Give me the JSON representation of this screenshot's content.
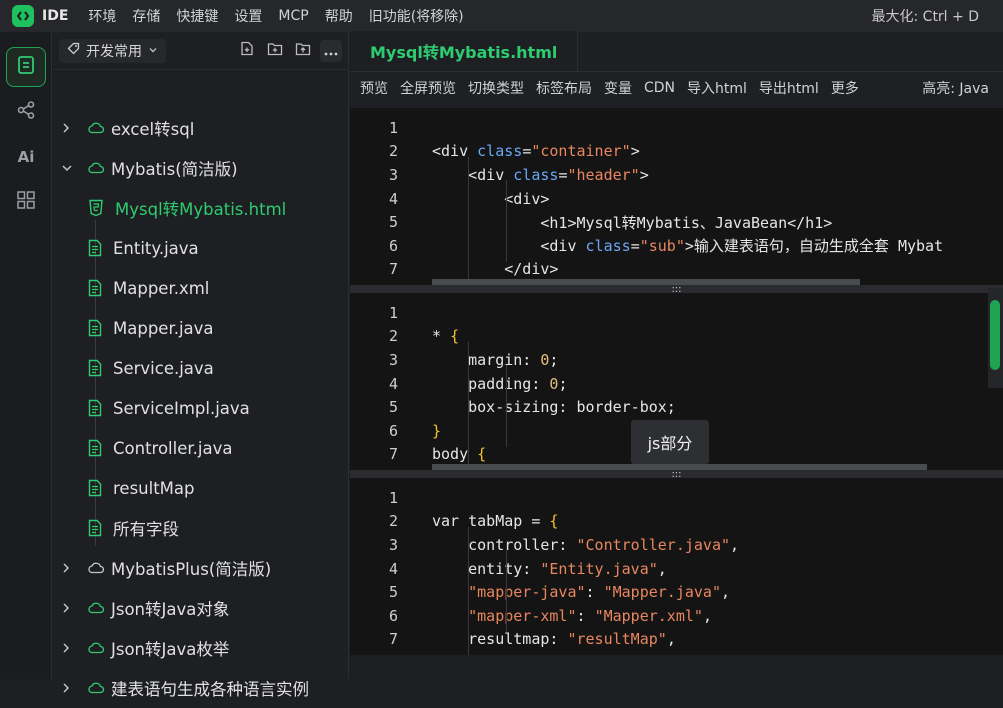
{
  "menubar": {
    "app_name": "IDE",
    "items": [
      "环境",
      "存储",
      "快捷键",
      "设置",
      "MCP",
      "帮助",
      "旧功能(将移除)"
    ],
    "maximize_hint": "最大化: Ctrl + D"
  },
  "activity": {
    "ai_label": "Ai"
  },
  "sidebar": {
    "workspace": "开发常用",
    "tree": [
      {
        "type": "folder",
        "label": "excel转sql",
        "expanded": false
      },
      {
        "type": "folder",
        "label": "Mybatis(简洁版)",
        "expanded": true
      },
      {
        "type": "file",
        "label": "Mysql转Mybatis.html",
        "icon": "html-file-icon",
        "active": true
      },
      {
        "type": "file",
        "label": "Entity.java",
        "icon": "file-icon"
      },
      {
        "type": "file",
        "label": "Mapper.xml",
        "icon": "file-icon"
      },
      {
        "type": "file",
        "label": "Mapper.java",
        "icon": "file-icon"
      },
      {
        "type": "file",
        "label": "Service.java",
        "icon": "file-icon"
      },
      {
        "type": "file",
        "label": "ServiceImpl.java",
        "icon": "file-icon"
      },
      {
        "type": "file",
        "label": "Controller.java",
        "icon": "file-icon"
      },
      {
        "type": "file",
        "label": "resultMap",
        "icon": "file-icon"
      },
      {
        "type": "file",
        "label": "所有字段",
        "icon": "file-icon"
      },
      {
        "type": "folder",
        "label": "MybatisPlus(简洁版)",
        "expanded": false
      },
      {
        "type": "folder",
        "label": "Json转Java对象",
        "expanded": false
      },
      {
        "type": "folder",
        "label": "Json转Java枚举",
        "expanded": false
      },
      {
        "type": "folder",
        "label": "建表语句生成各种语言实例",
        "expanded": false
      }
    ]
  },
  "editor": {
    "tab": "Mysql转Mybatis.html",
    "actions": [
      "预览",
      "全屏预览",
      "切换类型",
      "标签布局",
      "变量",
      "CDN",
      "导入html",
      "导出html",
      "更多"
    ],
    "highlight": "高亮: Java",
    "tooltip": "js部分",
    "html_pane": [
      {
        "n": "1",
        "tokens": []
      },
      {
        "n": "2",
        "tokens": [
          [
            "tag",
            "<div "
          ],
          [
            "attr",
            "class"
          ],
          [
            "tag",
            "="
          ],
          [
            "str",
            "\"container\""
          ],
          [
            "tag",
            ">"
          ]
        ]
      },
      {
        "n": "3",
        "tokens": [
          [
            "tag",
            "    <div "
          ],
          [
            "attr",
            "class"
          ],
          [
            "tag",
            "="
          ],
          [
            "str",
            "\"header\""
          ],
          [
            "tag",
            ">"
          ]
        ]
      },
      {
        "n": "4",
        "tokens": [
          [
            "tag",
            "        <div>"
          ]
        ]
      },
      {
        "n": "5",
        "tokens": [
          [
            "tag",
            "            <h1>Mysql转Mybatis、JavaBean</h1>"
          ]
        ]
      },
      {
        "n": "6",
        "tokens": [
          [
            "tag",
            "            <div "
          ],
          [
            "attr",
            "class"
          ],
          [
            "tag",
            "="
          ],
          [
            "str",
            "\"sub\""
          ],
          [
            "tag",
            ">输入建表语句，自动生成全套 Mybat"
          ]
        ]
      },
      {
        "n": "7",
        "tokens": [
          [
            "tag",
            "        </div>"
          ]
        ]
      }
    ],
    "css_pane": [
      {
        "n": "1",
        "tokens": []
      },
      {
        "n": "2",
        "tokens": [
          [
            "tag",
            "* "
          ],
          [
            "brace",
            "{"
          ]
        ]
      },
      {
        "n": "3",
        "tokens": [
          [
            "tag",
            "    margin: "
          ],
          [
            "num",
            "0"
          ],
          [
            "tag",
            ";"
          ]
        ]
      },
      {
        "n": "4",
        "tokens": [
          [
            "tag",
            "    padding: "
          ],
          [
            "num",
            "0"
          ],
          [
            "tag",
            ";"
          ]
        ]
      },
      {
        "n": "5",
        "tokens": [
          [
            "tag",
            "    box-sizing: border-box;"
          ]
        ]
      },
      {
        "n": "6",
        "tokens": [
          [
            "brace",
            "}"
          ]
        ]
      },
      {
        "n": "7",
        "tokens": [
          [
            "tag",
            "body "
          ],
          [
            "brace",
            "{"
          ]
        ]
      }
    ],
    "js_pane": [
      {
        "n": "1",
        "tokens": []
      },
      {
        "n": "2",
        "tokens": [
          [
            "tag",
            "var tabMap = "
          ],
          [
            "brace",
            "{"
          ]
        ]
      },
      {
        "n": "3",
        "tokens": [
          [
            "tag",
            "    controller: "
          ],
          [
            "str",
            "\"Controller.java\""
          ],
          [
            "tag",
            ","
          ]
        ]
      },
      {
        "n": "4",
        "tokens": [
          [
            "tag",
            "    entity: "
          ],
          [
            "str",
            "\"Entity.java\""
          ],
          [
            "tag",
            ","
          ]
        ]
      },
      {
        "n": "5",
        "tokens": [
          [
            "str",
            "    \"mapper-java\""
          ],
          [
            "tag",
            ": "
          ],
          [
            "str",
            "\"Mapper.java\""
          ],
          [
            "tag",
            ","
          ]
        ]
      },
      {
        "n": "6",
        "tokens": [
          [
            "str",
            "    \"mapper-xml\""
          ],
          [
            "tag",
            ": "
          ],
          [
            "str",
            "\"Mapper.xml\""
          ],
          [
            "tag",
            ","
          ]
        ]
      },
      {
        "n": "7",
        "tokens": [
          [
            "tag",
            "    resultmap: "
          ],
          [
            "str",
            "\"resultMap\""
          ],
          [
            "tag",
            ","
          ]
        ]
      }
    ]
  },
  "colors": {
    "accent": "#1fc15f",
    "active_file": "#2ecc71"
  }
}
